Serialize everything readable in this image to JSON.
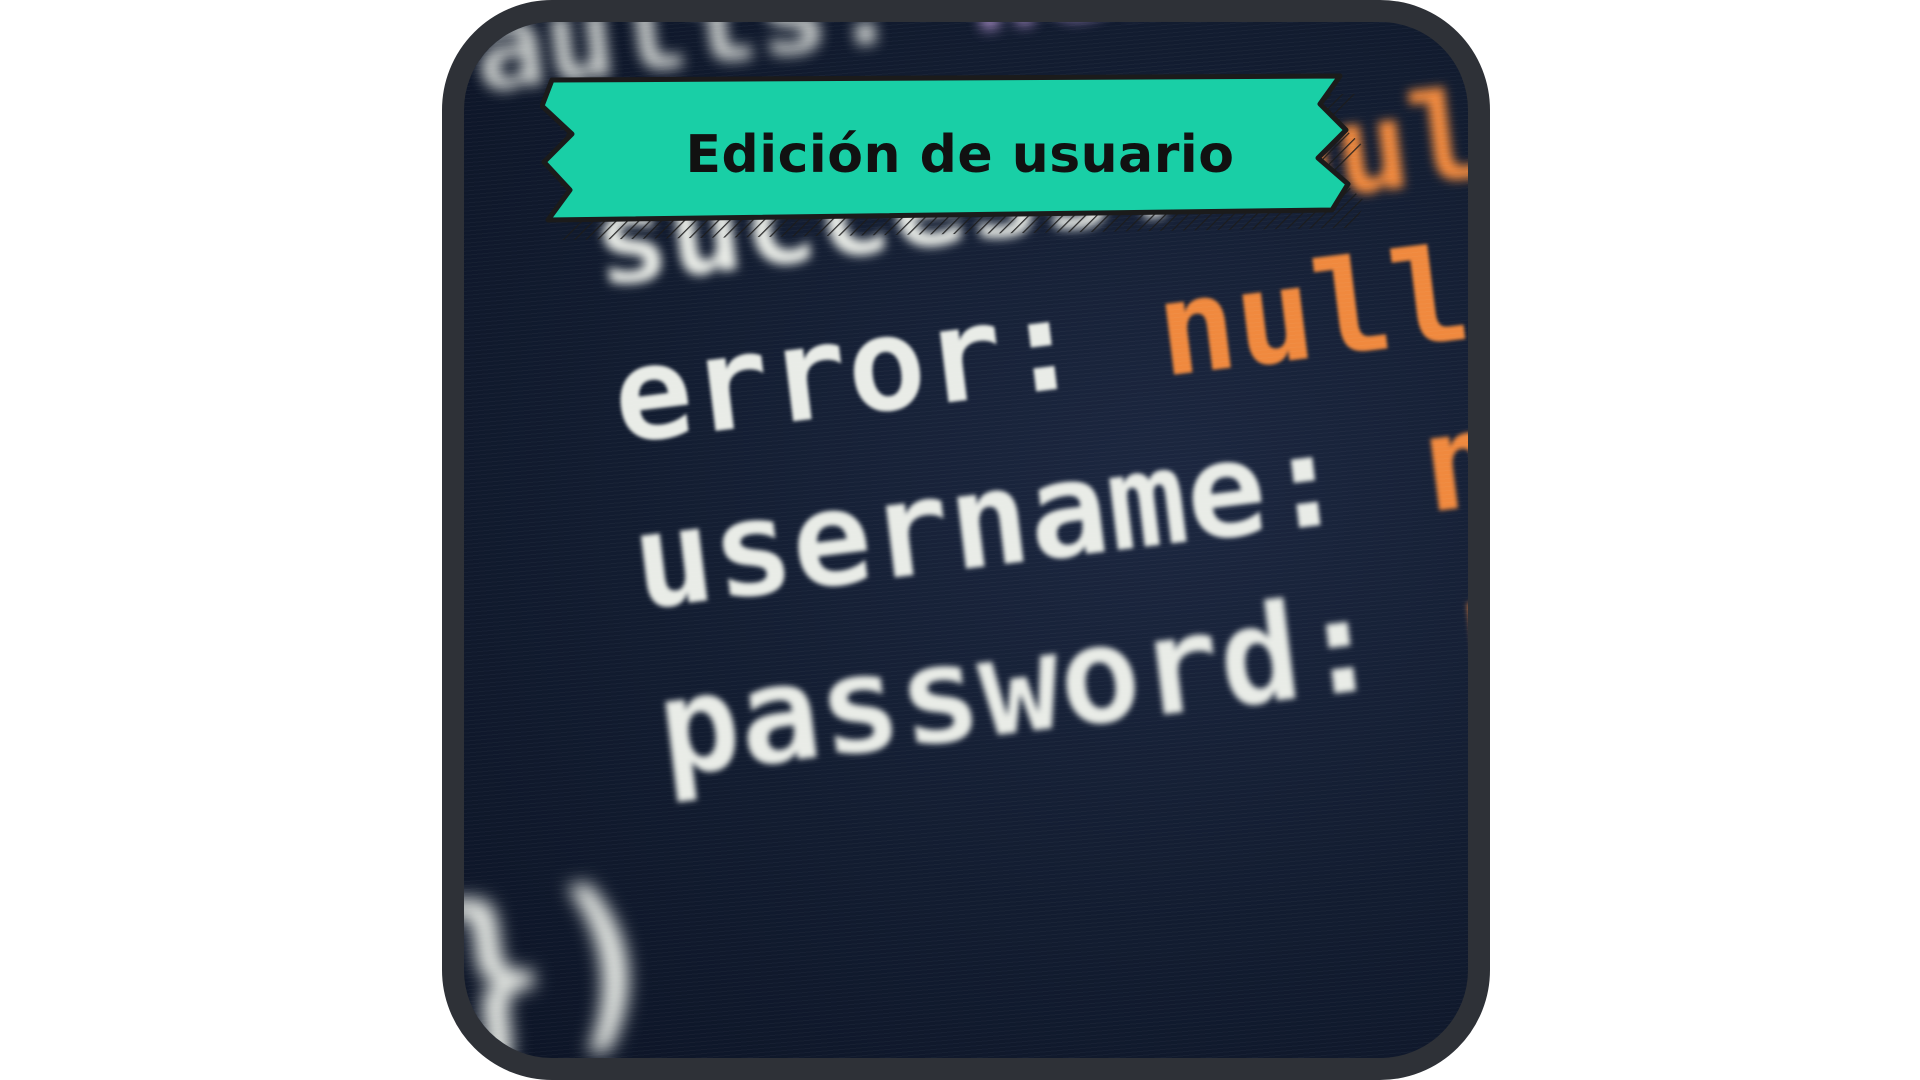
{
  "banner": {
    "title": "Edición de usuario",
    "fill_color": "#19cfa6",
    "outline_color": "#1b1b1b"
  },
  "frame": {
    "border_color": "#2e3137",
    "background_color": "#121c30"
  },
  "code_snippet": {
    "line_top": {
      "key": "aults:",
      "value": "new"
    },
    "line_success": {
      "key": "success:",
      "value": "null"
    },
    "line_error": {
      "key": "error:",
      "value": "null,"
    },
    "line_username": {
      "key": "username:",
      "value": "nu"
    },
    "line_password": {
      "key": "password:",
      "value": "nu"
    },
    "closing": "})",
    "colors": {
      "key": "#e9ece7",
      "value": "#f0893e",
      "keyword": "#c9a6e8"
    }
  }
}
